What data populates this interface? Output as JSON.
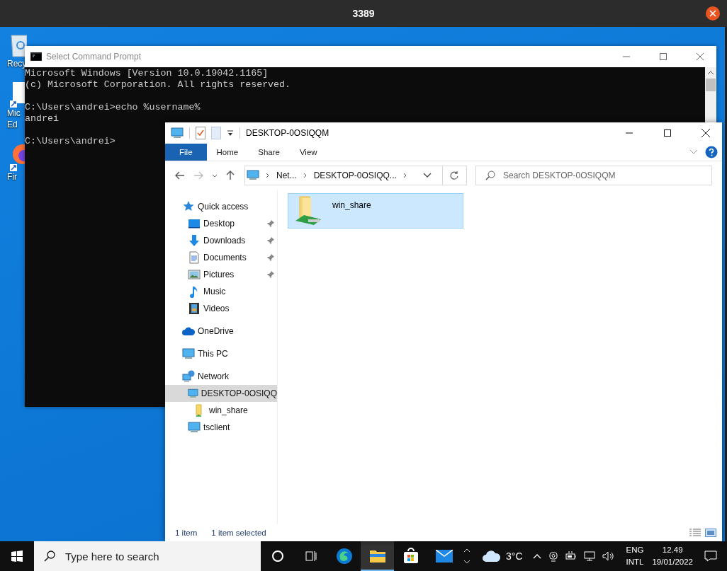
{
  "host_window": {
    "title": "3389"
  },
  "desktop_icons": [
    {
      "kind": "recycle",
      "lines": [
        "Recy"
      ]
    },
    {
      "kind": "edge",
      "lines": [
        "Mic",
        "Ed"
      ]
    },
    {
      "kind": "firefox",
      "lines": [
        "Fir"
      ]
    }
  ],
  "cmd": {
    "title": "Select Command Prompt",
    "blocks": [
      [
        "Microsoft Windows [Version 10.0.19042.1165]",
        "(c) Microsoft Corporation. All rights reserved."
      ],
      [
        "C:\\Users\\andrei>echo %username%",
        "andrei"
      ],
      [
        "C:\\Users\\andrei>"
      ]
    ]
  },
  "explorer": {
    "title": "DESKTOP-0OSIQQM",
    "ribbon_tabs": [
      {
        "label": "File",
        "selected": true
      },
      {
        "label": "Home",
        "selected": false
      },
      {
        "label": "Share",
        "selected": false
      },
      {
        "label": "View",
        "selected": false
      }
    ],
    "breadcrumb": [
      "Net...",
      "DESKTOP-0OSIQQ..."
    ],
    "search": {
      "placeholder": "Search DESKTOP-0OSIQQM"
    },
    "nav": [
      {
        "label": "Quick access",
        "kind": "star",
        "selected": false,
        "children": [
          {
            "label": "Desktop",
            "kind": "desktop",
            "selected": false,
            "pinned": true
          },
          {
            "label": "Downloads",
            "kind": "download",
            "selected": false,
            "pinned": true
          },
          {
            "label": "Documents",
            "kind": "document",
            "selected": false,
            "pinned": true
          },
          {
            "label": "Pictures",
            "kind": "pictures",
            "selected": false,
            "pinned": true
          },
          {
            "label": "Music",
            "kind": "music",
            "selected": false,
            "pinned": false
          },
          {
            "label": "Videos",
            "kind": "videos",
            "selected": false,
            "pinned": false
          }
        ]
      },
      {
        "label": "OneDrive",
        "kind": "cloud",
        "selected": false
      },
      {
        "label": "This PC",
        "kind": "pc",
        "selected": false
      },
      {
        "label": "Network",
        "kind": "network",
        "selected": false,
        "children": [
          {
            "label": "DESKTOP-0OSIQQ",
            "kind": "pc",
            "selected": true,
            "children": [
              {
                "label": "win_share",
                "kind": "share",
                "selected": false
              }
            ]
          },
          {
            "label": "tsclient",
            "kind": "pc",
            "selected": false
          }
        ]
      }
    ],
    "items": [
      {
        "name": "win_share",
        "selected": true
      }
    ],
    "status": [
      "1 item",
      "1 item selected"
    ]
  },
  "taskbar": {
    "search": {
      "placeholder": "Type here to search"
    },
    "apps": [
      {
        "kind": "cortana",
        "selected": false
      },
      {
        "kind": "taskview",
        "selected": false
      },
      {
        "kind": "edge",
        "selected": false
      },
      {
        "kind": "explorer",
        "selected": true
      },
      {
        "kind": "store",
        "selected": false
      },
      {
        "kind": "mail",
        "selected": false
      }
    ],
    "weather": "3°C",
    "language": [
      "ENG",
      "INTL"
    ],
    "time": "12.49",
    "date": "19/01/2022"
  }
}
